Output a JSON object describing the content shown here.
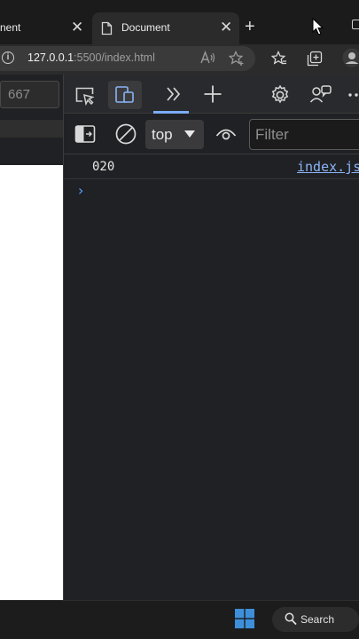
{
  "browser": {
    "tabs": [
      {
        "title": "nent",
        "close_glyph": "✕"
      },
      {
        "title": "Document",
        "close_glyph": "✕"
      }
    ],
    "new_tab_glyph": "+",
    "address": {
      "host": "127.0.0.1",
      "path": ":5500/index.html"
    }
  },
  "page": {
    "viewport_height": "667"
  },
  "devtools": {
    "console": {
      "context": "top",
      "filter_placeholder": "Filter",
      "messages": [
        {
          "text": "020",
          "source": "index.js"
        }
      ],
      "prompt_glyph": "›"
    }
  },
  "taskbar": {
    "search_label": "Search"
  },
  "colors": {
    "accent": "#7cacf8",
    "link": "#8ab4f8",
    "prompt": "#4fa3ff"
  }
}
